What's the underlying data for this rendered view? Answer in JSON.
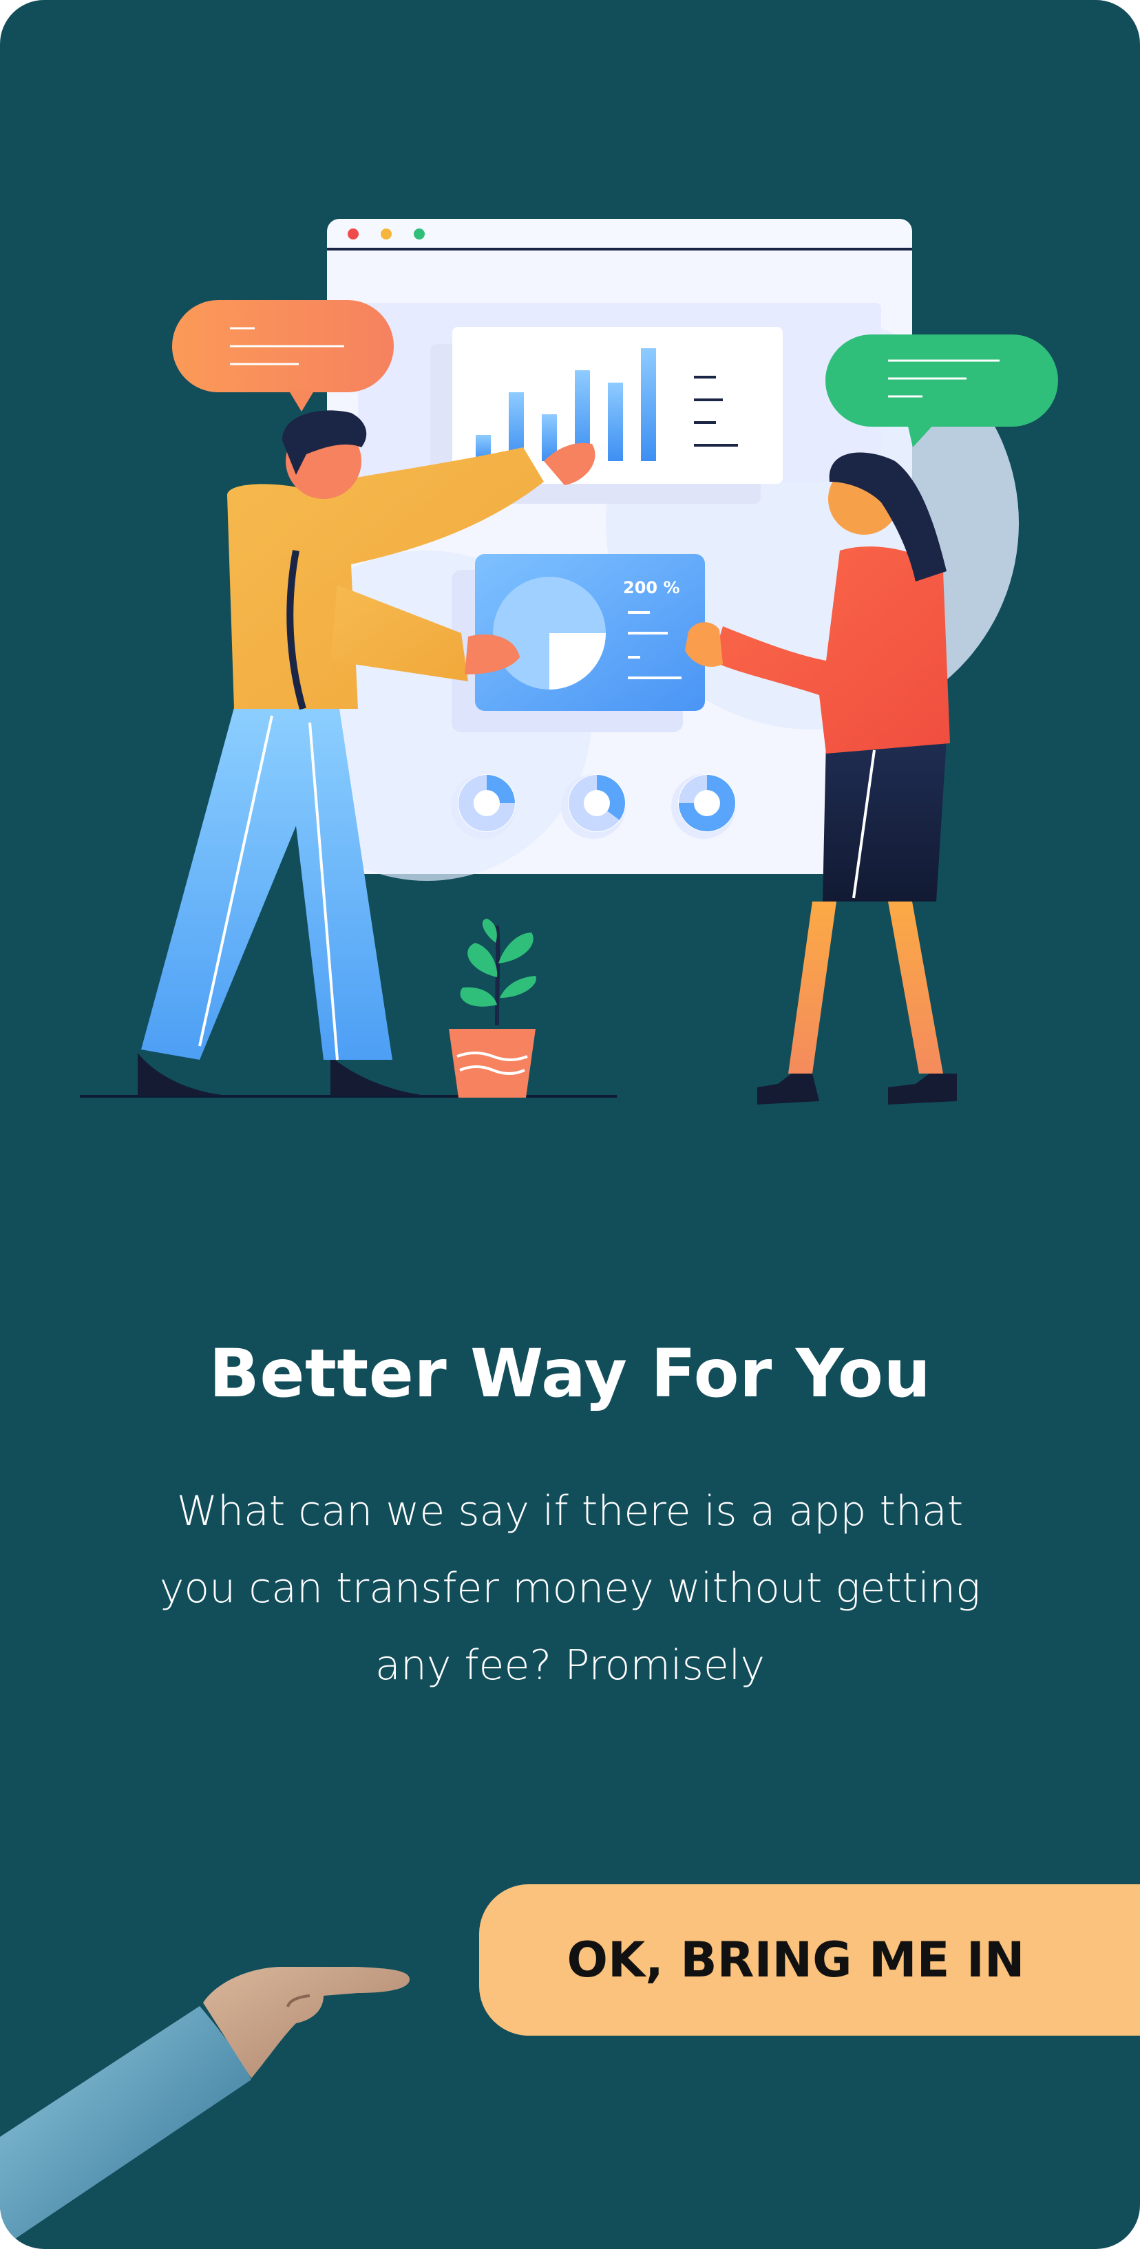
{
  "onboarding": {
    "title": "Better Way For You",
    "description": "What can we say if there is a app that you can transfer money without getting any fee? Promisely",
    "cta_label": "OK, BRING ME IN"
  },
  "illustration": {
    "percent_label": "200 %"
  },
  "colors": {
    "background": "#124d5a",
    "cta": "#fac27c",
    "bubble_orange": "#f8895a",
    "bubble_green": "#2fbf7a"
  }
}
